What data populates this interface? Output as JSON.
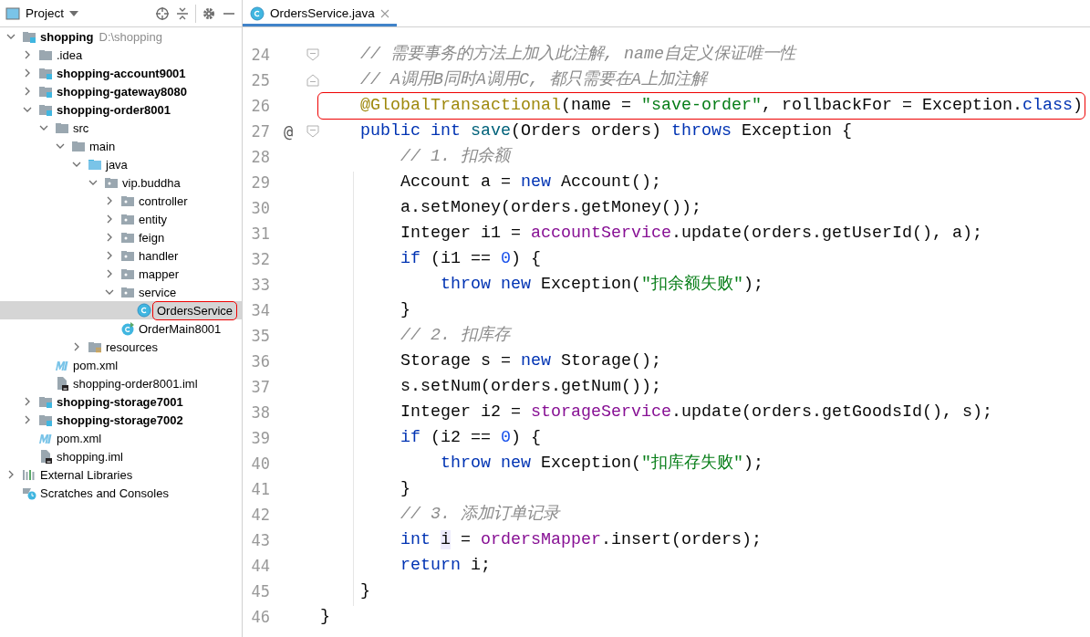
{
  "project_panel": {
    "title": "Project",
    "tree": [
      {
        "name": "shopping",
        "hint": "D:\\shopping",
        "bold": true,
        "kind": "module",
        "expanded": true,
        "selected": false,
        "children": [
          {
            "name": ".idea",
            "bold": false,
            "kind": "folder",
            "expanded": false,
            "selected": false
          },
          {
            "name": "shopping-account9001",
            "bold": true,
            "kind": "module",
            "expanded": false,
            "selected": false
          },
          {
            "name": "shopping-gateway8080",
            "bold": true,
            "kind": "module",
            "expanded": false,
            "selected": false
          },
          {
            "name": "shopping-order8001",
            "bold": true,
            "kind": "module",
            "expanded": true,
            "selected": false,
            "children": [
              {
                "name": "src",
                "bold": false,
                "kind": "folder",
                "expanded": true,
                "selected": false,
                "children": [
                  {
                    "name": "main",
                    "bold": false,
                    "kind": "folder",
                    "expanded": true,
                    "selected": false,
                    "children": [
                      {
                        "name": "java",
                        "bold": false,
                        "kind": "source",
                        "expanded": true,
                        "selected": false,
                        "children": [
                          {
                            "name": "vip.buddha",
                            "bold": false,
                            "kind": "package",
                            "expanded": true,
                            "selected": false,
                            "children": [
                              {
                                "name": "controller",
                                "bold": false,
                                "kind": "package",
                                "expanded": false,
                                "selected": false
                              },
                              {
                                "name": "entity",
                                "bold": false,
                                "kind": "package",
                                "expanded": false,
                                "selected": false
                              },
                              {
                                "name": "feign",
                                "bold": false,
                                "kind": "package",
                                "expanded": false,
                                "selected": false
                              },
                              {
                                "name": "handler",
                                "bold": false,
                                "kind": "package",
                                "expanded": false,
                                "selected": false
                              },
                              {
                                "name": "mapper",
                                "bold": false,
                                "kind": "package",
                                "expanded": false,
                                "selected": false
                              },
                              {
                                "name": "service",
                                "bold": false,
                                "kind": "package",
                                "expanded": true,
                                "selected": false,
                                "children": [
                                  {
                                    "name": "OrdersService",
                                    "bold": false,
                                    "kind": "class",
                                    "selected": true
                                  }
                                ]
                              },
                              {
                                "name": "OrderMain8001",
                                "bold": false,
                                "kind": "main",
                                "selected": false
                              }
                            ]
                          }
                        ]
                      },
                      {
                        "name": "resources",
                        "bold": false,
                        "kind": "resources",
                        "expanded": false,
                        "selected": false
                      }
                    ]
                  }
                ]
              },
              {
                "name": "pom.xml",
                "bold": false,
                "kind": "maven",
                "selected": false
              },
              {
                "name": "shopping-order8001.iml",
                "bold": false,
                "kind": "iml",
                "selected": false
              }
            ]
          },
          {
            "name": "shopping-storage7001",
            "bold": true,
            "kind": "module",
            "expanded": false,
            "selected": false
          },
          {
            "name": "shopping-storage7002",
            "bold": true,
            "kind": "module",
            "expanded": false,
            "selected": false
          },
          {
            "name": "pom.xml",
            "bold": false,
            "kind": "maven",
            "selected": false
          },
          {
            "name": "shopping.iml",
            "bold": false,
            "kind": "iml",
            "selected": false
          }
        ]
      },
      {
        "name": "External Libraries",
        "bold": false,
        "kind": "libraries",
        "expanded": false,
        "selected": false
      },
      {
        "name": "Scratches and Consoles",
        "bold": false,
        "kind": "scratches",
        "selected": false
      }
    ]
  },
  "editor": {
    "tabs": [
      {
        "label": "OrdersService.java",
        "selected": true
      }
    ],
    "lines": [
      {
        "number": "24",
        "fold_open": true,
        "tokens": [
          {
            "kind": "comment",
            "text": "    // 需要事务的方法上加入此注解, name自定义保证唯一性"
          }
        ]
      },
      {
        "number": "25",
        "fold_close": true,
        "tokens": [
          {
            "kind": "comment",
            "text": "    // A调用B同时A调用C, 都只需要在A上加注解"
          }
        ]
      },
      {
        "number": "26",
        "boxed": true,
        "tokens": [
          {
            "kind": "annotation",
            "text": "    @GlobalTransactional"
          },
          {
            "kind": "plain",
            "text": "(name = "
          },
          {
            "kind": "string",
            "text": "\"save-order\""
          },
          {
            "kind": "plain",
            "text": ", rollbackFor = Exception."
          },
          {
            "kind": "keyword",
            "text": "class"
          },
          {
            "kind": "plain",
            "text": ")"
          }
        ]
      },
      {
        "number": "27",
        "marker": "@",
        "fold_open": true,
        "tokens": [
          {
            "kind": "keyword",
            "text": "    public int "
          },
          {
            "kind": "method",
            "text": "save"
          },
          {
            "kind": "plain",
            "text": "(Orders orders) "
          },
          {
            "kind": "keyword",
            "text": "throws"
          },
          {
            "kind": "plain",
            "text": " Exception {"
          }
        ]
      },
      {
        "number": "28",
        "tokens": [
          {
            "kind": "comment",
            "text": "        // 1. 扣余额"
          }
        ]
      },
      {
        "number": "29",
        "tokens": [
          {
            "kind": "plain",
            "text": "        Account a = "
          },
          {
            "kind": "keyword",
            "text": "new"
          },
          {
            "kind": "plain",
            "text": " Account();"
          }
        ]
      },
      {
        "number": "30",
        "tokens": [
          {
            "kind": "plain",
            "text": "        a.setMoney(orders.getMoney());"
          }
        ]
      },
      {
        "number": "31",
        "tokens": [
          {
            "kind": "plain",
            "text": "        Integer i1 = "
          },
          {
            "kind": "field",
            "text": "accountService"
          },
          {
            "kind": "plain",
            "text": ".update(orders.getUserId(), a);"
          }
        ]
      },
      {
        "number": "32",
        "tokens": [
          {
            "kind": "keyword",
            "text": "        if"
          },
          {
            "kind": "plain",
            "text": " (i1 == "
          },
          {
            "kind": "number",
            "text": "0"
          },
          {
            "kind": "plain",
            "text": ") {"
          }
        ]
      },
      {
        "number": "33",
        "tokens": [
          {
            "kind": "keyword",
            "text": "            throw new"
          },
          {
            "kind": "plain",
            "text": " Exception("
          },
          {
            "kind": "string",
            "text": "\"扣余额失败\""
          },
          {
            "kind": "plain",
            "text": ");"
          }
        ]
      },
      {
        "number": "34",
        "tokens": [
          {
            "kind": "plain",
            "text": "        }"
          }
        ]
      },
      {
        "number": "35",
        "tokens": [
          {
            "kind": "comment",
            "text": "        // 2. 扣库存"
          }
        ]
      },
      {
        "number": "36",
        "tokens": [
          {
            "kind": "plain",
            "text": "        Storage s = "
          },
          {
            "kind": "keyword",
            "text": "new"
          },
          {
            "kind": "plain",
            "text": " Storage();"
          }
        ]
      },
      {
        "number": "37",
        "tokens": [
          {
            "kind": "plain",
            "text": "        s.setNum(orders.getNum());"
          }
        ]
      },
      {
        "number": "38",
        "tokens": [
          {
            "kind": "plain",
            "text": "        Integer i2 = "
          },
          {
            "kind": "field",
            "text": "storageService"
          },
          {
            "kind": "plain",
            "text": ".update(orders.getGoodsId(), s);"
          }
        ]
      },
      {
        "number": "39",
        "tokens": [
          {
            "kind": "keyword",
            "text": "        if"
          },
          {
            "kind": "plain",
            "text": " (i2 == "
          },
          {
            "kind": "number",
            "text": "0"
          },
          {
            "kind": "plain",
            "text": ") {"
          }
        ]
      },
      {
        "number": "40",
        "tokens": [
          {
            "kind": "keyword",
            "text": "            throw new"
          },
          {
            "kind": "plain",
            "text": " Exception("
          },
          {
            "kind": "string",
            "text": "\"扣库存失败\""
          },
          {
            "kind": "plain",
            "text": ");"
          }
        ]
      },
      {
        "number": "41",
        "tokens": [
          {
            "kind": "plain",
            "text": "        }"
          }
        ]
      },
      {
        "number": "42",
        "tokens": [
          {
            "kind": "comment",
            "text": "        // 3. 添加订单记录"
          }
        ]
      },
      {
        "number": "43",
        "tokens": [
          {
            "kind": "keyword",
            "text": "        int "
          },
          {
            "kind": "usage",
            "text": "i"
          },
          {
            "kind": "plain",
            "text": " = "
          },
          {
            "kind": "field",
            "text": "ordersMapper"
          },
          {
            "kind": "plain",
            "text": ".insert(orders);"
          }
        ]
      },
      {
        "number": "44",
        "tokens": [
          {
            "kind": "keyword",
            "text": "        return"
          },
          {
            "kind": "plain",
            "text": " i;"
          }
        ]
      },
      {
        "number": "45",
        "tokens": [
          {
            "kind": "plain",
            "text": "    }"
          }
        ]
      },
      {
        "number": "46",
        "tokens": [
          {
            "kind": "plain",
            "text": "}"
          }
        ]
      }
    ]
  }
}
